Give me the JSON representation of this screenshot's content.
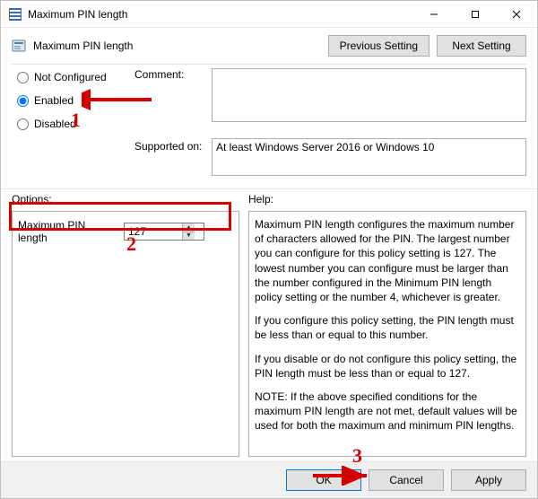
{
  "titlebar": {
    "title": "Maximum PIN length"
  },
  "header": {
    "policy_name": "Maximum PIN length",
    "previous_setting": "Previous Setting",
    "next_setting": "Next Setting"
  },
  "state": {
    "not_configured": "Not Configured",
    "enabled": "Enabled",
    "disabled": "Disabled",
    "selected": "Enabled",
    "comment_label": "Comment:",
    "comment_value": "",
    "supported_label": "Supported on:",
    "supported_value": "At least Windows Server 2016 or Windows 10"
  },
  "options": {
    "section_label": "Options:",
    "max_pin_label": "Maximum PIN length",
    "max_pin_value": "127"
  },
  "help": {
    "section_label": "Help:",
    "p1": "Maximum PIN length configures the maximum number of characters allowed for the PIN.  The largest number you can configure for this policy setting is 127. The lowest number you can configure must be larger than the number configured in the Minimum PIN length policy setting or the number 4, whichever is greater.",
    "p2": "If you configure this policy setting, the PIN length must be less than or equal to this number.",
    "p3": "If you disable or do not configure this policy setting, the PIN length must be less than or equal to 127.",
    "p4": "NOTE: If the above specified conditions for the maximum PIN length are not met, default values will be used for both the maximum and minimum PIN lengths."
  },
  "footer": {
    "ok": "OK",
    "cancel": "Cancel",
    "apply": "Apply"
  },
  "annotations": {
    "n1": "1",
    "n2": "2",
    "n3": "3"
  }
}
